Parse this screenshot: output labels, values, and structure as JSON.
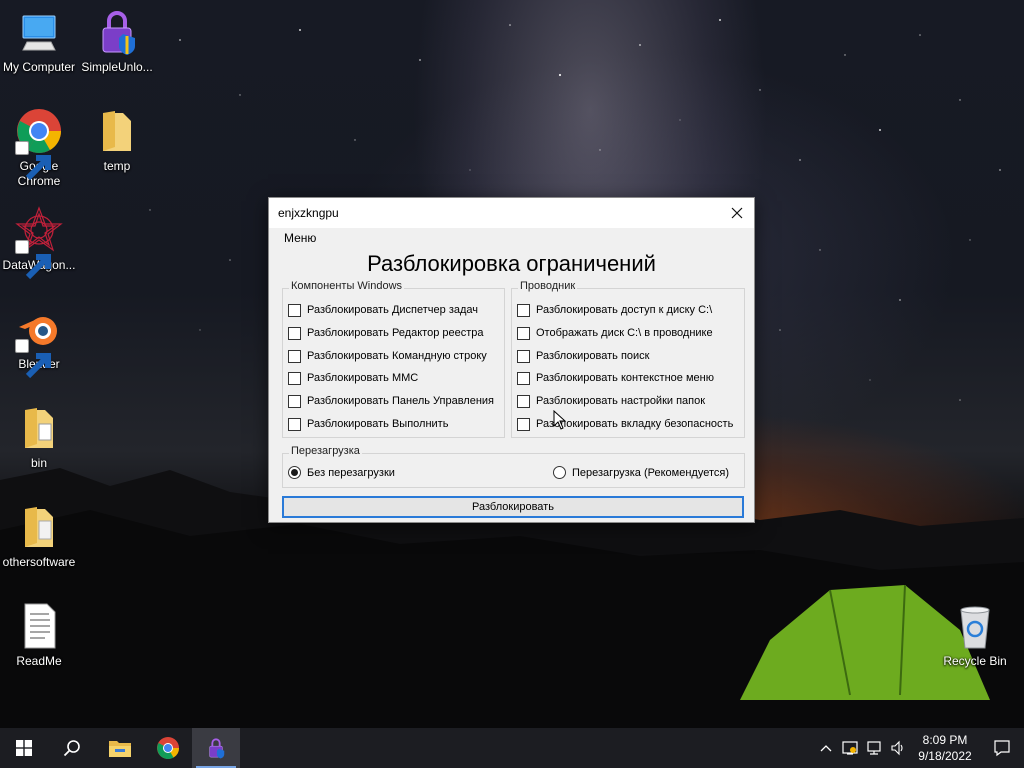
{
  "desktop": {
    "icons": [
      {
        "label": "My Computer",
        "icon": "monitor-icon"
      },
      {
        "label": "SimpleUnlo...",
        "icon": "lock-shield-icon"
      },
      {
        "label": "Google\nChrome",
        "icon": "chrome-icon"
      },
      {
        "label": "temp",
        "icon": "folder-icon"
      },
      {
        "label": "DataWagon...",
        "icon": "datawagon-icon"
      },
      {
        "label": "Blender",
        "icon": "blender-icon"
      },
      {
        "label": "bin",
        "icon": "folder-icon"
      },
      {
        "label": "othersoftware",
        "icon": "folder-icon"
      },
      {
        "label": "ReadMe",
        "icon": "text-file-icon"
      },
      {
        "label": "Recycle Bin",
        "icon": "recycle-bin-icon"
      }
    ]
  },
  "window": {
    "title": "enjxzkngpu",
    "menu": "Меню",
    "heading": "Разблокировка ограничений",
    "windows_group": {
      "legend": "Компоненты Windows",
      "options": [
        "Разблокировать Диспетчер задач",
        "Разблокировать Редактор реестра",
        "Разблокировать Командную строку",
        "Разблокировать MMC",
        "Разблокировать Панель Управления",
        "Разблокировать Выполнить"
      ]
    },
    "explorer_group": {
      "legend": "Проводник",
      "options": [
        "Разблокировать доступ к диску C:\\",
        "Отображать диск C:\\ в проводнике",
        "Разблокировать поиск",
        "Разблокировать контекстное меню",
        "Разблокировать настройки папок",
        "Разблокировать вкладку безопасность"
      ]
    },
    "reboot_group": {
      "legend": "Перезагрузка",
      "option_no_reboot": "Без перезагрузки",
      "option_reboot": "Перезагрузка (Рекомендуется)",
      "selected": "Без перезагрузки"
    },
    "unlock_button": "Разблокировать"
  },
  "taskbar": {
    "time": "8:09 PM",
    "date": "9/18/2022",
    "accent": "#79a6e6"
  }
}
